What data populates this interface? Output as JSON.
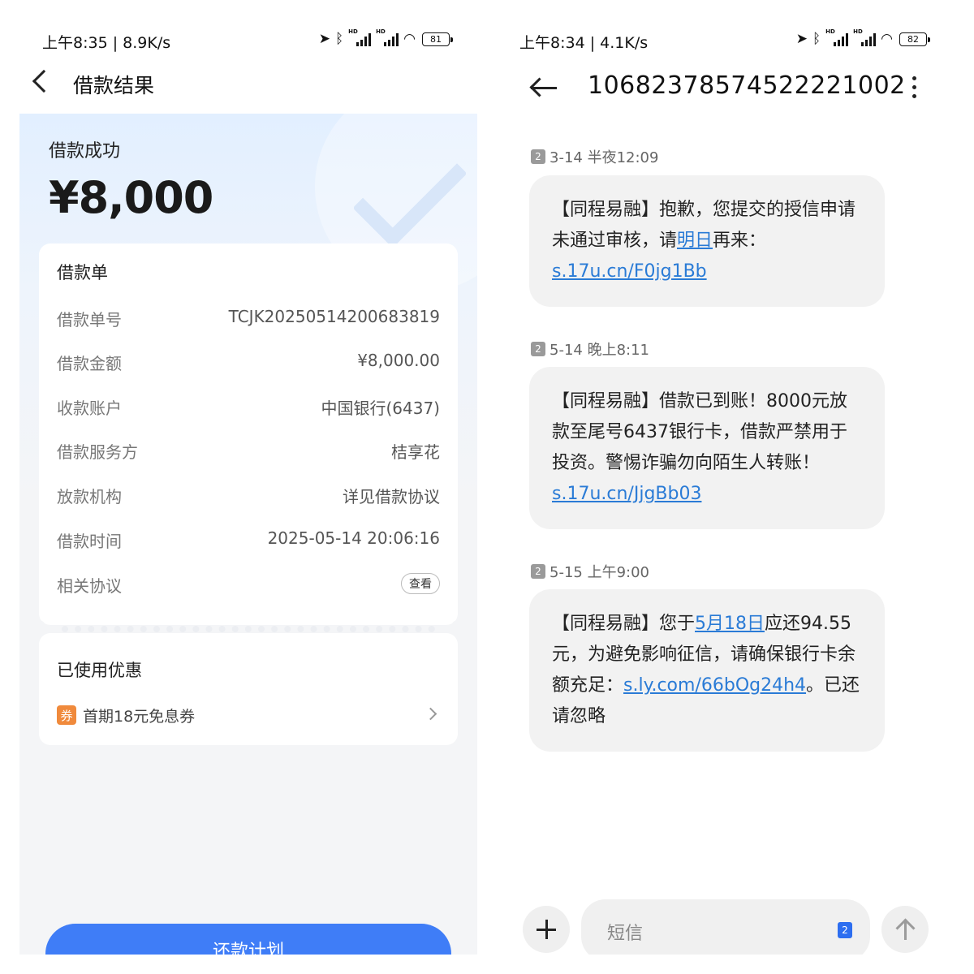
{
  "left": {
    "status": {
      "time": "上午8:35 | 8.9K/s",
      "battery": "81"
    },
    "nav": {
      "title": "借款结果"
    },
    "hero": {
      "label": "借款成功",
      "amount": "¥8,000"
    },
    "loan": {
      "title": "借款单",
      "rows": [
        {
          "key": "借款单号",
          "value": "TCJK20250514200683819"
        },
        {
          "key": "借款金额",
          "value": "¥8,000.00"
        },
        {
          "key": "收款账户",
          "value": "中国银行(6437)"
        },
        {
          "key": "借款服务方",
          "value": "桔享花"
        },
        {
          "key": "放款机构",
          "value": "详见借款协议"
        },
        {
          "key": "借款时间",
          "value": "2025-05-14 20:06:16"
        },
        {
          "key": "相关协议",
          "value": "查看"
        }
      ]
    },
    "coupon": {
      "title": "已使用优惠",
      "badge": "券",
      "text": "首期18元免息券"
    },
    "repay_button": "还款计划"
  },
  "right": {
    "status": {
      "time": "上午8:34 | 4.1K/s",
      "battery": "82"
    },
    "nav": {
      "title": "10682378574522221002"
    },
    "messages": [
      {
        "sim": "2",
        "time": "3-14 半夜12:09",
        "parts": [
          "【同程易融】抱歉，您提交的授信申请未通过审核，请",
          "明日",
          "再来：",
          "s.17u.cn/F0jg1Bb"
        ]
      },
      {
        "sim": "2",
        "time": "5-14 晚上8:11",
        "parts": [
          "【同程易融】借款已到账！8000元放款至尾号6437银行卡，借款严禁用于投资。警惕诈骗勿向陌生人转账！",
          "s.17u.cn/JjgBb03"
        ]
      },
      {
        "sim": "2",
        "time": "5-15 上午9:00",
        "parts": [
          "【同程易融】您于",
          "5月18日",
          "应还94.55元，为避免影响征信，请确保银行卡余额充足：",
          "s.ly.com/66bOg24h4",
          "。已还请忽略"
        ]
      }
    ],
    "composer": {
      "placeholder": "短信",
      "sim": "2"
    }
  }
}
